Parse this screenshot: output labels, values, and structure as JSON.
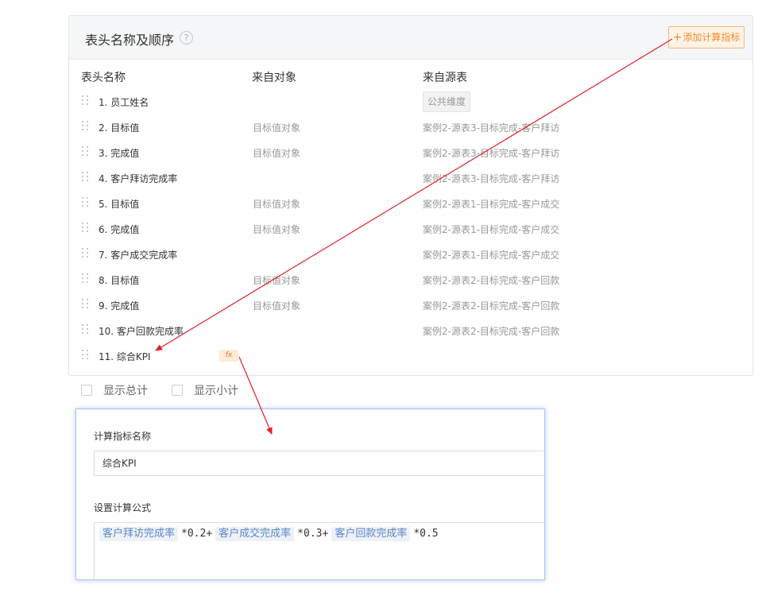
{
  "panel": {
    "title": "表头名称及顺序",
    "help_icon": "?",
    "add_button": {
      "plus": "+",
      "label": "添加计算指标"
    }
  },
  "columns": {
    "name": "表头名称",
    "object": "来自对象",
    "source": "来自源表"
  },
  "rows": [
    {
      "name": "1. 员工姓名",
      "object": "",
      "source": "",
      "tag": "公共维度"
    },
    {
      "name": "2. 目标值",
      "object": "目标值对象",
      "source": "案例2-源表3-目标完成-客户拜访"
    },
    {
      "name": "3. 完成值",
      "object": "目标值对象",
      "source": "案例2-源表3-目标完成-客户拜访"
    },
    {
      "name": "4. 客户拜访完成率",
      "object": "",
      "source": "案例2-源表3-目标完成-客户拜访"
    },
    {
      "name": "5. 目标值",
      "object": "目标值对象",
      "source": "案例2-源表1-目标完成-客户成交"
    },
    {
      "name": "6. 完成值",
      "object": "目标值对象",
      "source": "案例2-源表1-目标完成-客户成交"
    },
    {
      "name": "7. 客户成交完成率",
      "object": "",
      "source": "案例2-源表1-目标完成-客户成交"
    },
    {
      "name": "8. 目标值",
      "object": "目标值对象",
      "source": "案例2-源表2-目标完成-客户回款"
    },
    {
      "name": "9. 完成值",
      "object": "目标值对象",
      "source": "案例2-源表2-目标完成-客户回款"
    },
    {
      "name": "10. 客户回款完成率",
      "object": "",
      "source": "案例2-源表2-目标完成-客户回款"
    },
    {
      "name": "11. 综合KPI",
      "object": "",
      "source": "",
      "fx": "fx"
    }
  ],
  "options": {
    "show_total": "显示总计",
    "show_subtotal": "显示小计"
  },
  "popup": {
    "name_label": "计算指标名称",
    "name_value": "综合KPI",
    "formula_label": "设置计算公式",
    "formula": {
      "tag1": "客户拜访完成率",
      "op1": "*0.2+",
      "tag2": "客户成交完成率",
      "op2": "*0.3+",
      "tag3": "客户回款完成率",
      "op3": "*0.5"
    }
  },
  "colors": {
    "accent_orange": "#f08c2e",
    "annotation_red": "#e0202a",
    "formula_tag_blue": "#5b86c9"
  }
}
